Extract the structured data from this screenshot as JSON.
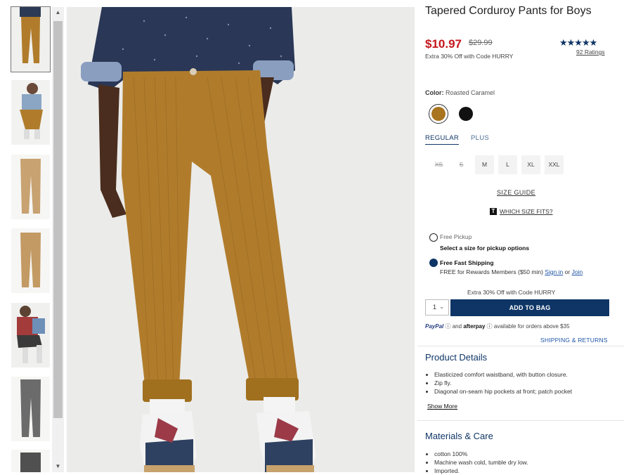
{
  "product": {
    "title": "Tapered Corduroy Pants for Boys",
    "price": "$10.97",
    "original_price": "$29.99",
    "promo": "Extra 30% Off with Code HURRY",
    "stars": "★★★★★",
    "rating_value": 4.5,
    "ratings_link": "92 Ratings"
  },
  "color": {
    "label": "Color:",
    "value": "Roasted Caramel",
    "swatches": [
      {
        "name": "Roasted Caramel",
        "hex": "#a9741f"
      },
      {
        "name": "Black",
        "hex": "#111111"
      }
    ]
  },
  "fit_tabs": [
    "REGULAR",
    "PLUS"
  ],
  "sizes": [
    {
      "label": "XS",
      "available": false
    },
    {
      "label": "S",
      "available": false
    },
    {
      "label": "M",
      "available": true
    },
    {
      "label": "L",
      "available": true
    },
    {
      "label": "XL",
      "available": true
    },
    {
      "label": "XXL",
      "available": true
    }
  ],
  "size_guide": "SIZE GUIDE",
  "which_size": "WHICH SIZE FITS?",
  "fulfillment": {
    "pickup_label": "Free Pickup",
    "pickup_note": "Select a size for pickup options",
    "shipping_label": "Free Fast Shipping",
    "shipping_note": "FREE for Rewards Members ($50 min)",
    "sign_in": "Sign in",
    "or": "or",
    "join": "Join"
  },
  "cart": {
    "promo": "Extra 30% Off with Code HURRY",
    "quantity": "1",
    "add_to_bag": "ADD TO BAG"
  },
  "payment": {
    "paypal": "PayPal",
    "and": "and",
    "afterpay": "afterpay",
    "note": "available for orders above $35"
  },
  "shipping_returns": "SHIPPING & RETURNS",
  "details": {
    "heading": "Product Details",
    "items": [
      "Elasticized comfort waistband, with button closure.",
      "Zip fly.",
      "Diagonal on-seam hip pockets at front; patch pocket"
    ],
    "show_more": "Show More"
  },
  "materials": {
    "heading": "Materials & Care",
    "items": [
      "cotton 100%",
      "Machine wash cold, tumble dry low.",
      "Imported."
    ]
  },
  "colors": {
    "brand_navy": "#0e3566",
    "price_red": "#c4161c",
    "pant_caramel": "#b07c2c"
  }
}
